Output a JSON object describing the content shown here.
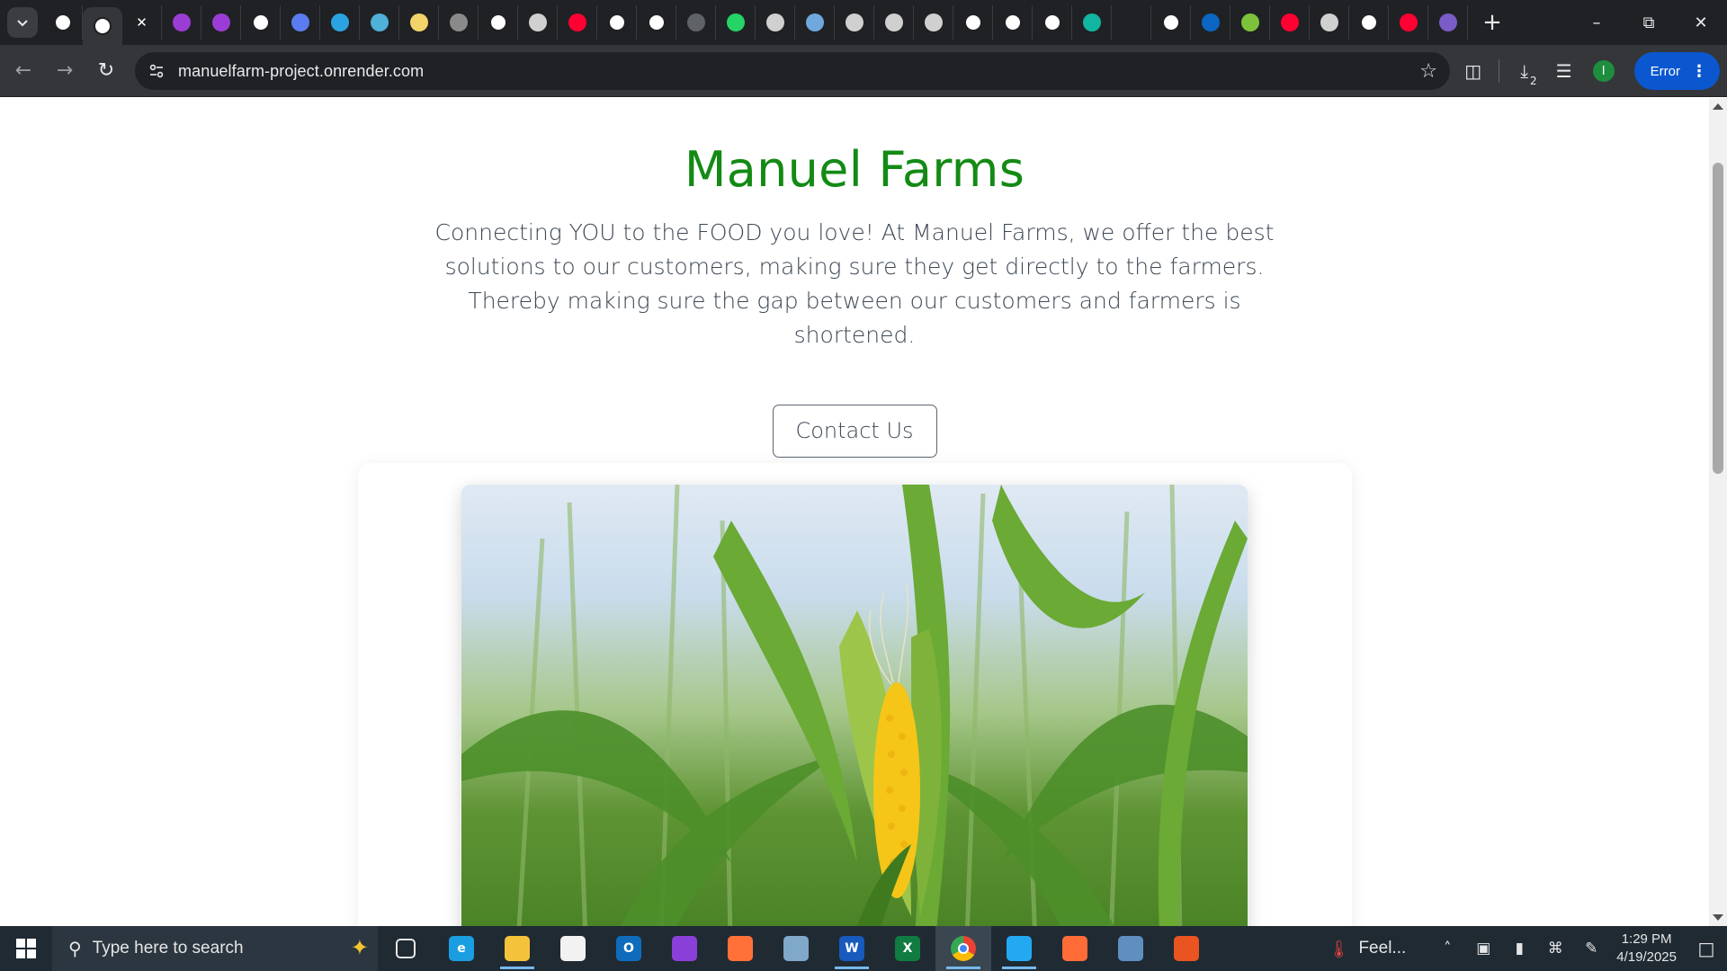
{
  "browser": {
    "tabs": [
      {
        "icon": "github-icon",
        "color": "#ffffff"
      },
      {
        "icon": "extension-puzzle-icon",
        "color": "#ffffff",
        "active": true
      },
      {
        "icon": "close-icon",
        "color": "#ffffff"
      },
      {
        "icon": "u-badge-icon",
        "color": "#9b3dd4"
      },
      {
        "icon": "u-badge-icon",
        "color": "#9b3dd4"
      },
      {
        "icon": "openai-icon",
        "color": "#ffffff"
      },
      {
        "icon": "bird-icon",
        "color": "#5b7cf0"
      },
      {
        "icon": "telegram-icon",
        "color": "#2aa3e0"
      },
      {
        "icon": "bird-icon",
        "color": "#4fb0d8"
      },
      {
        "icon": "circle-b-icon",
        "color": "#f2d46b"
      },
      {
        "icon": "file-icon",
        "color": "#8a8a8a"
      },
      {
        "icon": "github-icon",
        "color": "#ffffff"
      },
      {
        "icon": "lambda-icon",
        "color": "#d0d0d0"
      },
      {
        "icon": "youtube-icon",
        "color": "#ff0033"
      },
      {
        "icon": "github-icon",
        "color": "#ffffff"
      },
      {
        "icon": "github-icon",
        "color": "#ffffff"
      },
      {
        "icon": "file-icon",
        "color": "#5f6368"
      },
      {
        "icon": "whatsapp-icon",
        "color": "#25d366"
      },
      {
        "icon": "globe-icon",
        "color": "#d0d0d0"
      },
      {
        "icon": "shield-icon",
        "color": "#6fa8dc"
      },
      {
        "icon": "globe-icon",
        "color": "#d0d0d0"
      },
      {
        "icon": "globe-icon",
        "color": "#d0d0d0"
      },
      {
        "icon": "globe-icon",
        "color": "#d0d0d0"
      },
      {
        "icon": "google-icon",
        "color": "#ffffff"
      },
      {
        "icon": "google-icon",
        "color": "#ffffff"
      },
      {
        "icon": "google-icon",
        "color": "#ffffff"
      },
      {
        "icon": "diamond-icon",
        "color": "#12b5a0"
      },
      {
        "icon": "blank-icon",
        "color": "#202124"
      },
      {
        "icon": "google-icon",
        "color": "#ffffff"
      },
      {
        "icon": "linkedin-icon",
        "color": "#0a66c2"
      },
      {
        "icon": "download-arrow-icon",
        "color": "#7cc23a"
      },
      {
        "icon": "youtube-icon",
        "color": "#ff0033"
      },
      {
        "icon": "globe-icon",
        "color": "#d0d0d0"
      },
      {
        "icon": "google-icon",
        "color": "#ffffff"
      },
      {
        "icon": "youtube-icon",
        "color": "#ff0033"
      },
      {
        "icon": "settings-gear-icon",
        "color": "#7a5cc8"
      }
    ],
    "url": "manuelfarm-project.onrender.com",
    "profile_initial": "I",
    "download_count": "2",
    "error_label": "Error"
  },
  "page": {
    "title": "Manuel Farms",
    "tagline": "Connecting YOU to the FOOD you love! At Manuel Farms, we offer the best solutions to our customers, making sure they get directly to the farmers. Thereby making sure the gap between our customers and farmers is shortened.",
    "contact_button": "Contact Us",
    "title_color": "#138a14"
  },
  "taskbar": {
    "search_placeholder": "Type here to search",
    "weather_label": "Feel...",
    "time": "1:29 PM",
    "date": "4/19/2025",
    "apps": [
      {
        "name": "task-view-icon",
        "label": "",
        "color": "#1f2a33"
      },
      {
        "name": "edge-icon",
        "label": "e",
        "color": "#1b9de2"
      },
      {
        "name": "file-explorer-icon",
        "label": "",
        "color": "#f5c33b",
        "running": true
      },
      {
        "name": "microsoft-store-icon",
        "label": "",
        "color": "#f2f2f2"
      },
      {
        "name": "outlook-icon",
        "label": "O",
        "color": "#0f6cbd"
      },
      {
        "name": "mask-app-icon",
        "label": "",
        "color": "#8b3fd9"
      },
      {
        "name": "firefox-icon",
        "label": "",
        "color": "#ff7139"
      },
      {
        "name": "notes-app-icon",
        "label": "",
        "color": "#7fa8c9"
      },
      {
        "name": "word-icon",
        "label": "W",
        "color": "#185abd",
        "running": true
      },
      {
        "name": "excel-icon",
        "label": "X",
        "color": "#107c41"
      },
      {
        "name": "chrome-icon",
        "label": "",
        "color": "#1f2a33",
        "running": true,
        "active": true
      },
      {
        "name": "vscode-icon",
        "label": "",
        "color": "#23a9f2",
        "running": true
      },
      {
        "name": "postman-icon",
        "label": "",
        "color": "#ff6c37"
      },
      {
        "name": "postgres-icon",
        "label": "",
        "color": "#5e8fbf"
      },
      {
        "name": "ubuntu-icon",
        "label": "",
        "color": "#e95420"
      }
    ]
  }
}
